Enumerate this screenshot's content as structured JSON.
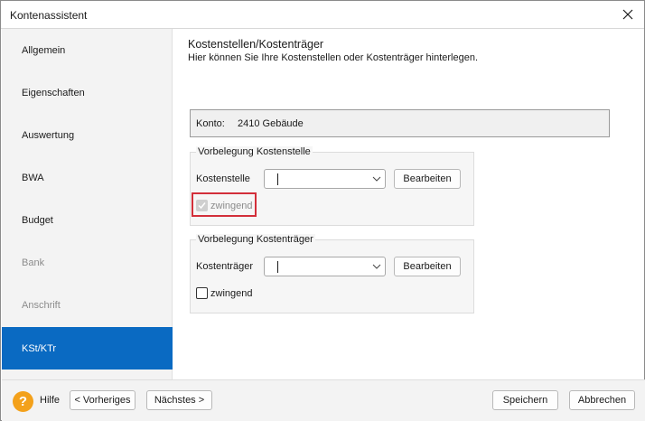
{
  "window": {
    "title": "Kontenassistent"
  },
  "sidebar": {
    "items": [
      {
        "label": "Allgemein"
      },
      {
        "label": "Eigenschaften"
      },
      {
        "label": "Auswertung"
      },
      {
        "label": "BWA"
      },
      {
        "label": "Budget"
      },
      {
        "label": "Bank",
        "state": "disabled"
      },
      {
        "label": "Anschrift",
        "state": "disabled"
      },
      {
        "label": "KSt/KTr",
        "state": "selected"
      }
    ]
  },
  "main": {
    "heading": "Kostenstellen/Kostenträger",
    "subheading": "Hier können Sie Ihre Kostenstellen oder Kostenträger hinterlegen.",
    "konto": {
      "label": "Konto:",
      "value": "2410 Gebäude"
    },
    "kostenstelle_group": {
      "legend": "Vorbelegung Kostenstelle",
      "field_label": "Kostenstelle",
      "combo_value": "",
      "edit_button": "Bearbeiten",
      "required_label": "zwingend",
      "required_checked": true,
      "required_disabled": true
    },
    "kostentraeger_group": {
      "legend": "Vorbelegung Kostenträger",
      "field_label": "Kostenträger",
      "combo_value": "",
      "edit_button": "Bearbeiten",
      "required_label": "zwingend",
      "required_checked": false
    }
  },
  "footer": {
    "help_icon": "question-icon",
    "help_label": "Hilfe",
    "prev_button": "< Vorheriges",
    "next_button": "Nächstes >",
    "save_button": "Speichern",
    "cancel_button": "Abbrechen"
  },
  "colors": {
    "accent": "#0a6ac2",
    "help_icon": "#f3a11b",
    "highlight": "#d32f3a"
  }
}
